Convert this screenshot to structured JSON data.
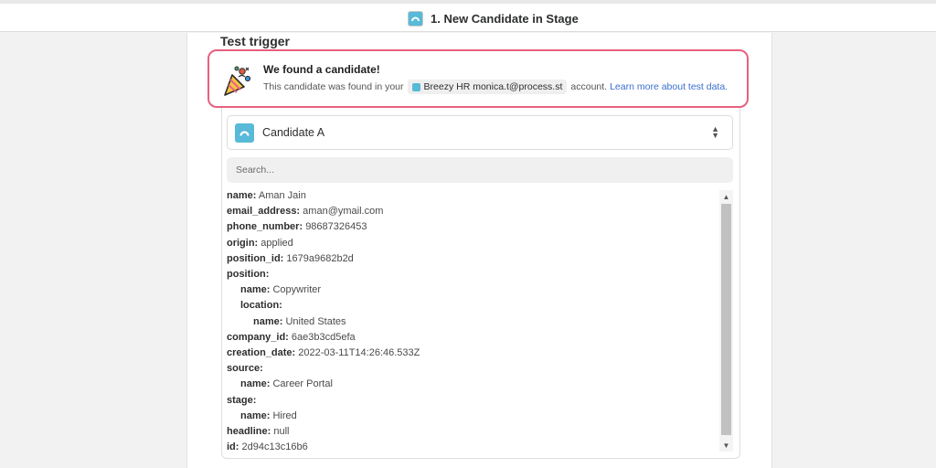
{
  "header": {
    "title": "1. New Candidate in Stage",
    "app_icon": "breezy-hr-icon"
  },
  "section": {
    "title": "Test trigger"
  },
  "notice": {
    "title": "We found a candidate!",
    "prefix": "This candidate was found in your",
    "account": "Breezy HR monica.t@process.st",
    "suffix": "account.",
    "link": "Learn more about test data.",
    "border_color": "#e8607f",
    "icon": "party-popper-icon"
  },
  "selector": {
    "selected": "Candidate A"
  },
  "search": {
    "placeholder": "Search..."
  },
  "fields": [
    {
      "key": "name:",
      "value": "Aman Jain",
      "indent": 0
    },
    {
      "key": "email_address:",
      "value": "aman@ymail.com",
      "indent": 0
    },
    {
      "key": "phone_number:",
      "value": "98687326453",
      "indent": 0
    },
    {
      "key": "origin:",
      "value": "applied",
      "indent": 0
    },
    {
      "key": "position_id:",
      "value": "1679a9682b2d",
      "indent": 0
    },
    {
      "key": "position:",
      "value": "",
      "indent": 0
    },
    {
      "key": "name:",
      "value": "Copywriter",
      "indent": 1
    },
    {
      "key": "location:",
      "value": "",
      "indent": 1
    },
    {
      "key": "name:",
      "value": "United States",
      "indent": 2
    },
    {
      "key": "company_id:",
      "value": "6ae3b3cd5efa",
      "indent": 0
    },
    {
      "key": "creation_date:",
      "value": "2022-03-11T14:26:46.533Z",
      "indent": 0
    },
    {
      "key": "source:",
      "value": "",
      "indent": 0
    },
    {
      "key": "name:",
      "value": "Career Portal",
      "indent": 1
    },
    {
      "key": "stage:",
      "value": "",
      "indent": 0
    },
    {
      "key": "name:",
      "value": "Hired",
      "indent": 1
    },
    {
      "key": "headline:",
      "value": "null",
      "indent": 0
    },
    {
      "key": "id:",
      "value": "2d94c13c16b6",
      "indent": 0
    }
  ],
  "colors": {
    "accent": "#58b9d8",
    "link": "#3a6fcf"
  }
}
